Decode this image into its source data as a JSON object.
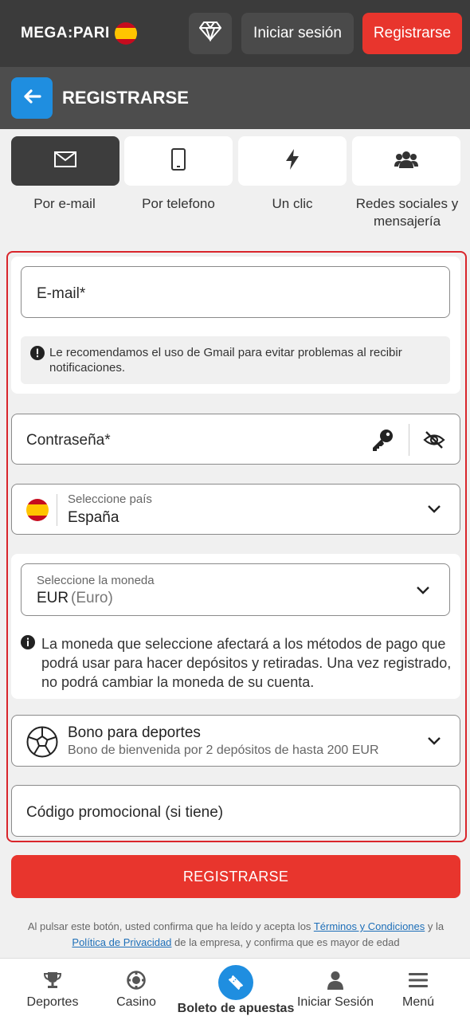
{
  "header": {
    "logo_text": "MEGA:PARI",
    "login_label": "Iniciar sesión",
    "register_label": "Registrarse"
  },
  "titlebar": {
    "title": "REGISTRARSE"
  },
  "tabs": [
    {
      "label": "Por e-mail",
      "icon": "envelope-icon",
      "active": true
    },
    {
      "label": "Por telefono",
      "icon": "phone-icon",
      "active": false
    },
    {
      "label": "Un clic",
      "icon": "lightning-icon",
      "active": false
    },
    {
      "label": "Redes sociales y mensajería",
      "icon": "users-icon",
      "active": false
    }
  ],
  "form": {
    "email_placeholder": "E-mail*",
    "gmail_hint": "Le recomendamos el uso de Gmail para evitar problemas al recibir notificaciones.",
    "password_placeholder": "Contraseña*",
    "country_label": "Seleccione país",
    "country_value": "España",
    "currency_label": "Seleccione la moneda",
    "currency_code": "EUR",
    "currency_name": "(Euro)",
    "currency_hint": "La moneda que seleccione afectará a los métodos de pago que podrá usar para hacer depósitos y retiradas. Una vez registrado, no podrá cambiar la moneda de su cuenta.",
    "bonus_title": "Bono para deportes",
    "bonus_desc": "Bono de bienvenida por 2 depósitos de hasta 200 EUR",
    "promo_placeholder": "Código promocional (si tiene)"
  },
  "submit_label": "REGISTRARSE",
  "legal": {
    "part1": "Al pulsar este botón, usted confirma que ha leído y acepta los ",
    "terms_link": "Términos y Condiciones",
    "part2": " y la ",
    "privacy_link": "Política de Privacidad",
    "part3": " de la empresa, y confirma que es mayor de edad"
  },
  "bottom_nav": [
    {
      "label": "Deportes",
      "icon": "trophy-icon"
    },
    {
      "label": "Casino",
      "icon": "casino-chip-icon"
    },
    {
      "label": "Boleto de apuestas",
      "icon": "ticket-icon"
    },
    {
      "label": "Iniciar Sesión",
      "icon": "user-icon"
    },
    {
      "label": "Menú",
      "icon": "menu-icon"
    }
  ],
  "colors": {
    "accent_red": "#e8352d",
    "accent_blue": "#1f8ee0",
    "header_bg": "#3b3b3b"
  }
}
